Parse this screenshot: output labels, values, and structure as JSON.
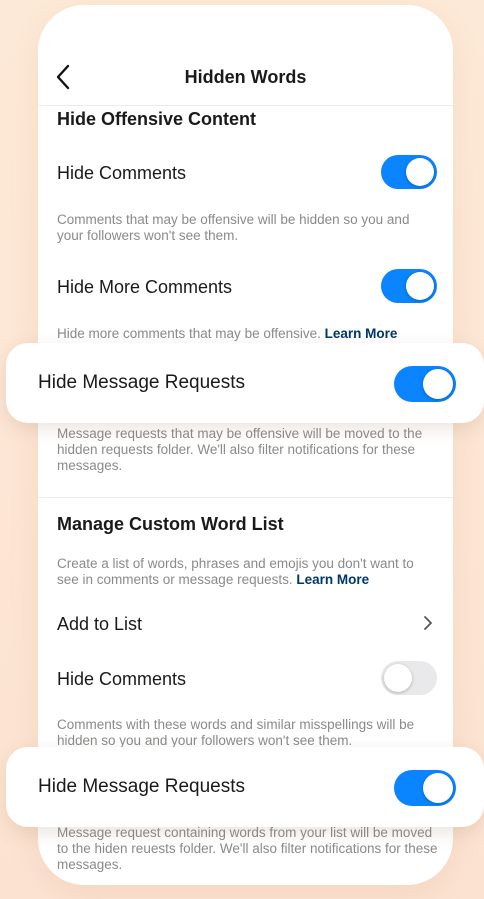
{
  "header": {
    "title": "Hidden Words"
  },
  "section1": {
    "title": "Hide Offensive Content",
    "hide_comments": {
      "label": "Hide Comments",
      "enabled": true,
      "description": "Comments that may be offensive will be hidden so you and your followers won't see them."
    },
    "hide_more_comments": {
      "label": "Hide More Comments",
      "enabled": true,
      "description": "Hide more comments that may be offensive.",
      "link": "Learn More"
    },
    "hide_message_requests": {
      "label": "Hide Message Requests",
      "enabled": true,
      "description": "Message requests that may be offensive will be moved to the hidden requests folder. We'll also filter notifications for these messages."
    }
  },
  "section2": {
    "title": "Manage Custom Word List",
    "description": "Create a list of words, phrases and emojis you don't want to see in comments or message requests.",
    "link": "Learn More",
    "add_to_list": {
      "label": "Add to List"
    },
    "hide_comments": {
      "label": "Hide Comments",
      "enabled": false,
      "description": "Comments with these words and similar misspellings will be hidden so you and your followers won't see them."
    },
    "hide_message_requests": {
      "label": "Hide Message Requests",
      "enabled": true,
      "description": "Message request containing words from your list will be moved to the hiden reuests folder. We'll also filter notifications for these messages."
    }
  },
  "colors": {
    "toggle_on": "#0a84ff",
    "toggle_off": "#e9e9eb",
    "link": "#00376b"
  },
  "icons": {
    "back": "chevron-left-icon",
    "add_to_list": "chevron-right-icon"
  }
}
